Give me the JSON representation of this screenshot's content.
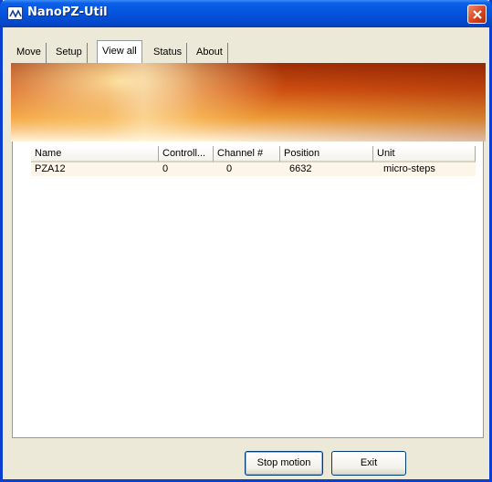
{
  "window": {
    "title": "NanoPZ-Util",
    "icon": "nanopz-app-icon",
    "close_icon": "close-icon"
  },
  "tabs": [
    {
      "label": "Move",
      "selected": false
    },
    {
      "label": "Setup",
      "selected": false
    },
    {
      "label": "View all",
      "selected": true
    },
    {
      "label": "Status",
      "selected": false
    },
    {
      "label": "About",
      "selected": false
    }
  ],
  "table": {
    "columns": [
      "Name",
      "Controll...",
      "Channel #",
      "Position",
      "Unit"
    ],
    "rows": [
      [
        "PZA12",
        "0",
        "0",
        "6632",
        "micro-steps"
      ]
    ]
  },
  "buttons": {
    "stop_motion": "Stop motion",
    "exit": "Exit"
  },
  "colors": {
    "titlebar": "#0553dc",
    "close_button": "#d5401c",
    "window_face": "#ece9d8",
    "banner": "#f3a23a",
    "row_highlight": "#fdf6e8"
  }
}
